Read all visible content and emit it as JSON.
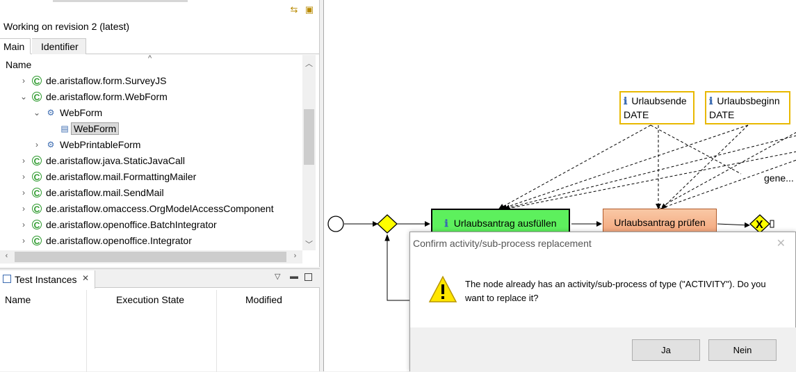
{
  "explorer": {
    "revision_label": "Working on revision 2 (latest)",
    "tabs": [
      "Main",
      "Identifier"
    ],
    "column_header": "Name",
    "items": [
      {
        "label": "de.aristaflow.form.SurveyJS",
        "icon": "component-icon",
        "expander": "›"
      },
      {
        "label": "de.aristaflow.form.WebForm",
        "icon": "component-icon",
        "expander": "⌄"
      },
      {
        "label": "WebForm",
        "icon": "form-package-icon",
        "expander": "⌄"
      },
      {
        "label": "WebForm",
        "icon": "form-class-icon",
        "expander": "",
        "selected": true
      },
      {
        "label": "WebPrintableForm",
        "icon": "form-package-icon",
        "expander": "›"
      },
      {
        "label": "de.aristaflow.java.StaticJavaCall",
        "icon": "component-icon",
        "expander": "›"
      },
      {
        "label": "de.aristaflow.mail.FormattingMailer",
        "icon": "component-icon",
        "expander": "›"
      },
      {
        "label": "de.aristaflow.mail.SendMail",
        "icon": "component-icon",
        "expander": "›"
      },
      {
        "label": "de.aristaflow.omaccess.OrgModelAccessComponent",
        "icon": "component-icon",
        "expander": "›"
      },
      {
        "label": "de.aristaflow.openoffice.BatchIntegrator",
        "icon": "component-icon",
        "expander": "›"
      },
      {
        "label": "de.aristaflow.openoffice.Integrator",
        "icon": "component-icon",
        "expander": "›"
      }
    ]
  },
  "test_instances": {
    "tab_label": "Test Instances",
    "columns": [
      "Name",
      "Execution State",
      "Modified"
    ]
  },
  "diagram": {
    "data_elements": [
      {
        "name": "Urlaubsende",
        "type": "DATE"
      },
      {
        "name": "Urlaubsbeginn",
        "type": "DATE"
      }
    ],
    "activities": [
      "Urlaubsantrag ausfüllen",
      "Urlaubsantrag prüfen"
    ],
    "edge_label": "gene..."
  },
  "dialog": {
    "title": "Confirm activity/sub-process replacement",
    "message": "The node already has an activity/sub-process of type (\"ACTIVITY\"). Do you want to replace it?",
    "yes_label": "Ja",
    "no_label": "Nein"
  },
  "colors": {
    "activity_active": "#5df05d",
    "activity_pending": "#f3a57a",
    "gateway": "#ffff00",
    "data_border": "#e8b800"
  }
}
